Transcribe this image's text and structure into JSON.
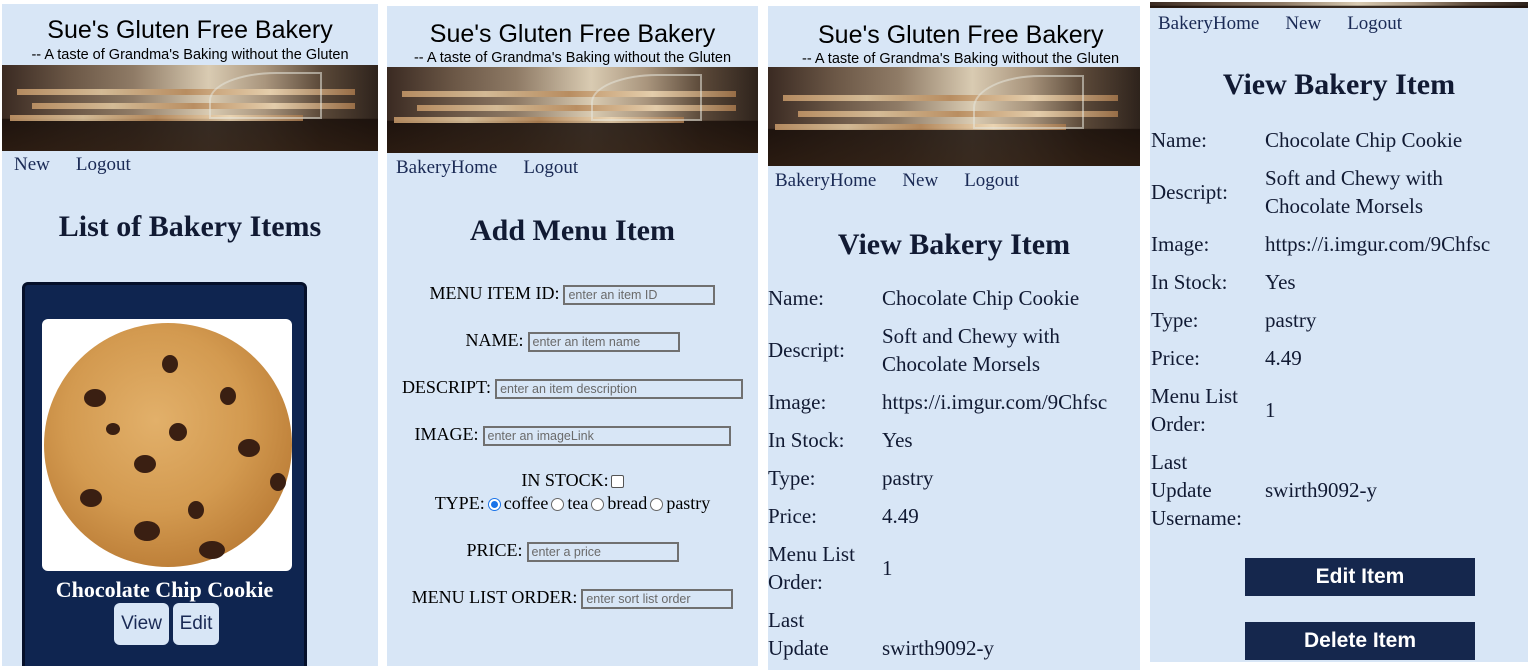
{
  "site": {
    "title": "Sue's Gluten Free Bakery",
    "tagline": "-- A taste of Grandma's Baking without the Gluten"
  },
  "panel_list": {
    "nav": [
      "New",
      "Logout"
    ],
    "heading": "List of Bakery Items",
    "card": {
      "title": "Chocolate Chip Cookie",
      "view_label": "View",
      "edit_label": "Edit"
    }
  },
  "panel_add": {
    "nav": [
      "BakeryHome",
      "Logout"
    ],
    "heading": "Add Menu Item",
    "fields": {
      "item_id": {
        "label": "MENU ITEM ID:",
        "placeholder": "enter an item ID"
      },
      "name": {
        "label": "NAME:",
        "placeholder": "enter an item name"
      },
      "descript": {
        "label": "DESCRIPT:",
        "placeholder": "enter an item description"
      },
      "image": {
        "label": "IMAGE:",
        "placeholder": "enter an imageLink"
      },
      "in_stock": {
        "label": "IN STOCK:",
        "checked": false
      },
      "type": {
        "label": "TYPE:",
        "options": [
          "coffee",
          "tea",
          "bread",
          "pastry"
        ],
        "selected": "coffee"
      },
      "price": {
        "label": "PRICE:",
        "placeholder": "enter a price"
      },
      "list_order": {
        "label": "MENU LIST ORDER:",
        "placeholder": "enter sort list order"
      }
    }
  },
  "panel_view": {
    "nav": [
      "BakeryHome",
      "New",
      "Logout"
    ],
    "heading": "View Bakery Item",
    "labels": {
      "name": "Name:",
      "descript": "Descript:",
      "image": "Image:",
      "in_stock": "In Stock:",
      "type": "Type:",
      "price": "Price:",
      "order_line1": "Menu List",
      "order_line2": "Order:",
      "update_line1": "Last",
      "update_line2": "Update",
      "update_line3": "Username:"
    },
    "values": {
      "name": "Chocolate Chip Cookie",
      "descript_line1": "Soft and Chewy with",
      "descript_line2": "Chocolate Morsels",
      "image": "https://i.imgur.com/9Chfsc",
      "in_stock": "Yes",
      "type": "pastry",
      "price": "4.49",
      "order": "1",
      "update": "swirth9092-y"
    }
  },
  "panel_view_scrolled": {
    "nav": [
      "BakeryHome",
      "New",
      "Logout"
    ],
    "heading": "View Bakery Item",
    "edit_button": "Edit Item",
    "delete_button": "Delete Item"
  }
}
